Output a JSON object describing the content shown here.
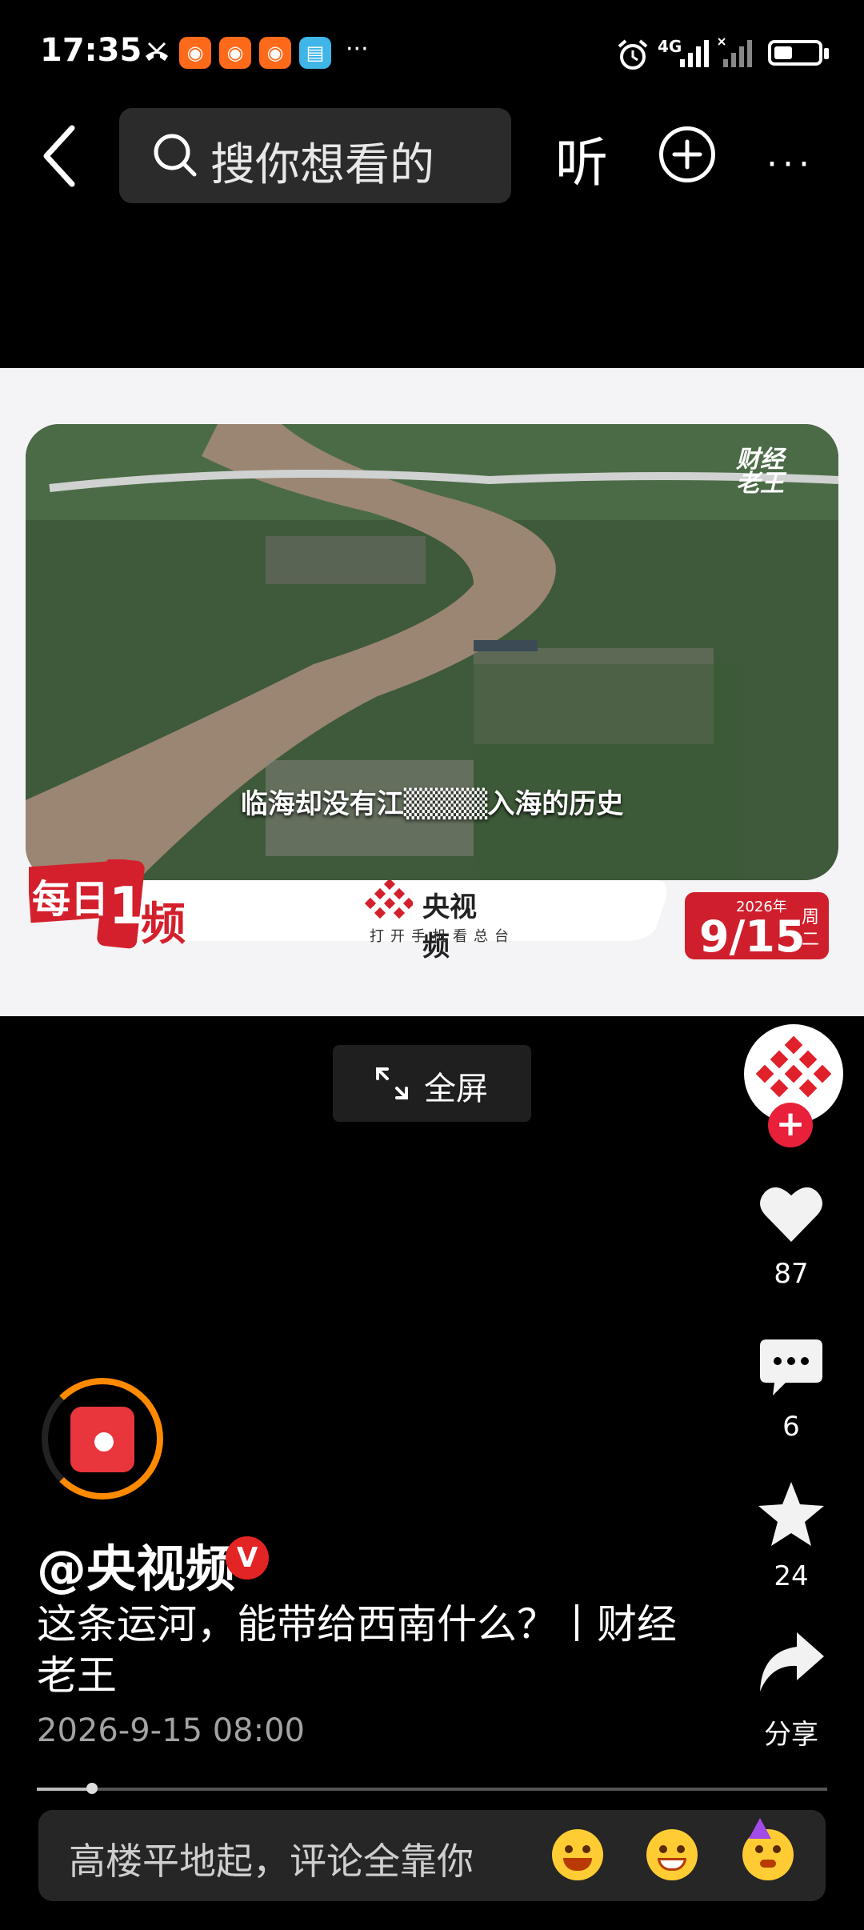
{
  "status_bar": {
    "time": "17:35",
    "app_badges": [
      "kuaishou-app-icon",
      "kuaishou-app-icon",
      "kuaishou-app-icon",
      "reader-app-icon"
    ],
    "more": "···",
    "network": "4G"
  },
  "top_bar": {
    "search_placeholder": "搜你想看的",
    "listen_label": "听",
    "more_label": "···"
  },
  "video": {
    "subtitle": "临海却没有江▒▒▒▒入海的历史",
    "corner_logo": "财经\n老王",
    "meiri_logo": "每日1频",
    "cctv_name": "央视频",
    "cctv_slogan": "打开手机看总台",
    "date_year": "2026年",
    "date_day": "9/15",
    "date_week": "周二"
  },
  "fullscreen": {
    "label": "全屏"
  },
  "actions": {
    "follow": "+",
    "likes": "87",
    "comments": "6",
    "favorites": "24",
    "share": "分享"
  },
  "author": {
    "handle": "@央视频",
    "verified": "V"
  },
  "post": {
    "title": "这条运河，能带给西南什么？丨财经老王",
    "time": "2026-9-15 08:00"
  },
  "progress": {
    "fraction": 0.07
  },
  "comment_bar": {
    "placeholder": "高楼平地起，评论全靠你"
  },
  "colors": {
    "accent_red": "#e8203a",
    "ring_orange": "#ff8a00",
    "background": "#000000"
  }
}
